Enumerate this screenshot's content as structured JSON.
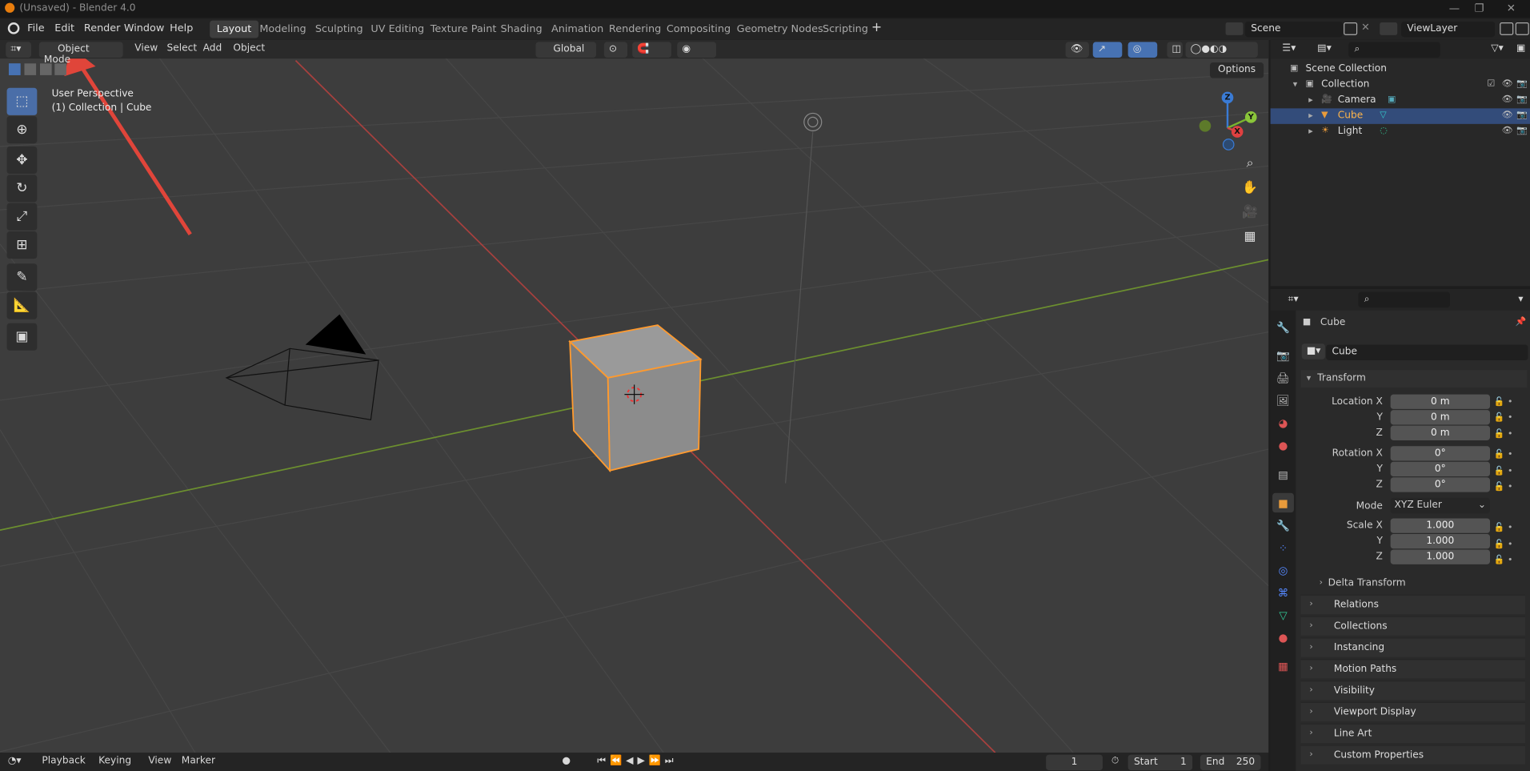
{
  "window": {
    "title": "(Unsaved) - Blender 4.0"
  },
  "menu": [
    "File",
    "Edit",
    "Render",
    "Window",
    "Help"
  ],
  "workspaces": [
    "Layout",
    "Modeling",
    "Sculpting",
    "UV Editing",
    "Texture Paint",
    "Shading",
    "Animation",
    "Rendering",
    "Compositing",
    "Geometry Nodes",
    "Scripting"
  ],
  "scene": {
    "name": "Scene",
    "view_layer": "ViewLayer"
  },
  "viewport": {
    "mode": "Object Mode",
    "menus": [
      "View",
      "Select",
      "Add",
      "Object"
    ],
    "orientation": "Global",
    "options": "Options",
    "overlay_line1": "User Perspective",
    "overlay_line2": "(1) Collection | Cube",
    "axes": {
      "x": "X",
      "y": "Y",
      "z": "Z"
    }
  },
  "timeline": {
    "menus": [
      "Playback",
      "Keying",
      "View",
      "Marker"
    ],
    "current_frame": "1",
    "start_label": "Start",
    "start": "1",
    "end_label": "End",
    "end": "250"
  },
  "outliner": {
    "root": "Scene Collection",
    "collection": "Collection",
    "items": [
      "Camera",
      "Cube",
      "Light"
    ]
  },
  "properties": {
    "object_name": "Cube",
    "data_name": "Cube",
    "transform_header": "Transform",
    "location_label": "Location X",
    "rotation_label": "Rotation X",
    "scale_label": "Scale X",
    "y_label": "Y",
    "z_label": "Z",
    "mode_label": "Mode",
    "location": [
      "0 m",
      "0 m",
      "0 m"
    ],
    "rotation": [
      "0°",
      "0°",
      "0°"
    ],
    "rotation_mode": "XYZ Euler",
    "scale": [
      "1.000",
      "1.000",
      "1.000"
    ],
    "subpanels": [
      "Delta Transform",
      "Relations",
      "Collections",
      "Instancing",
      "Motion Paths",
      "Visibility",
      "Viewport Display",
      "Line Art",
      "Custom Properties"
    ]
  },
  "colors": {
    "accent": "#4772b3",
    "selection": "#ff9a2e",
    "x_axis": "#c0392b",
    "y_axis": "#7fa02f"
  }
}
